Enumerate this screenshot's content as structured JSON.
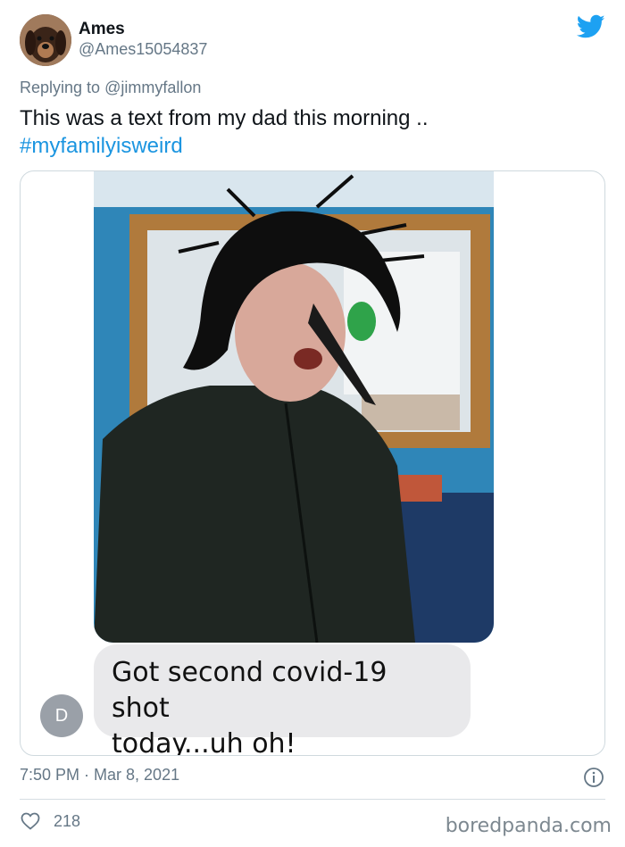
{
  "author": {
    "name": "Ames",
    "handle": "@Ames15054837"
  },
  "reply": {
    "prefix": "Replying to",
    "mention": "@jimmyfallon"
  },
  "tweet": {
    "text": "This was a text from my dad this morning ..",
    "hashtag": "#myfamilyisweird"
  },
  "message": {
    "sender_initial": "D",
    "text_line1": "Got second covid-19 shot",
    "text_line2": "today...uh oh!"
  },
  "meta": {
    "timestamp": "7:50 PM · Mar 8, 2021",
    "likes": "218"
  },
  "watermark": "boredpanda.com",
  "icons": {
    "logo": "twitter-bird-icon",
    "info": "info-icon",
    "like": "heart-icon"
  },
  "colors": {
    "link": "#1b95e0",
    "twitter_blue": "#1da1f2",
    "muted": "#657786",
    "bubble": "#e9e9eb"
  }
}
